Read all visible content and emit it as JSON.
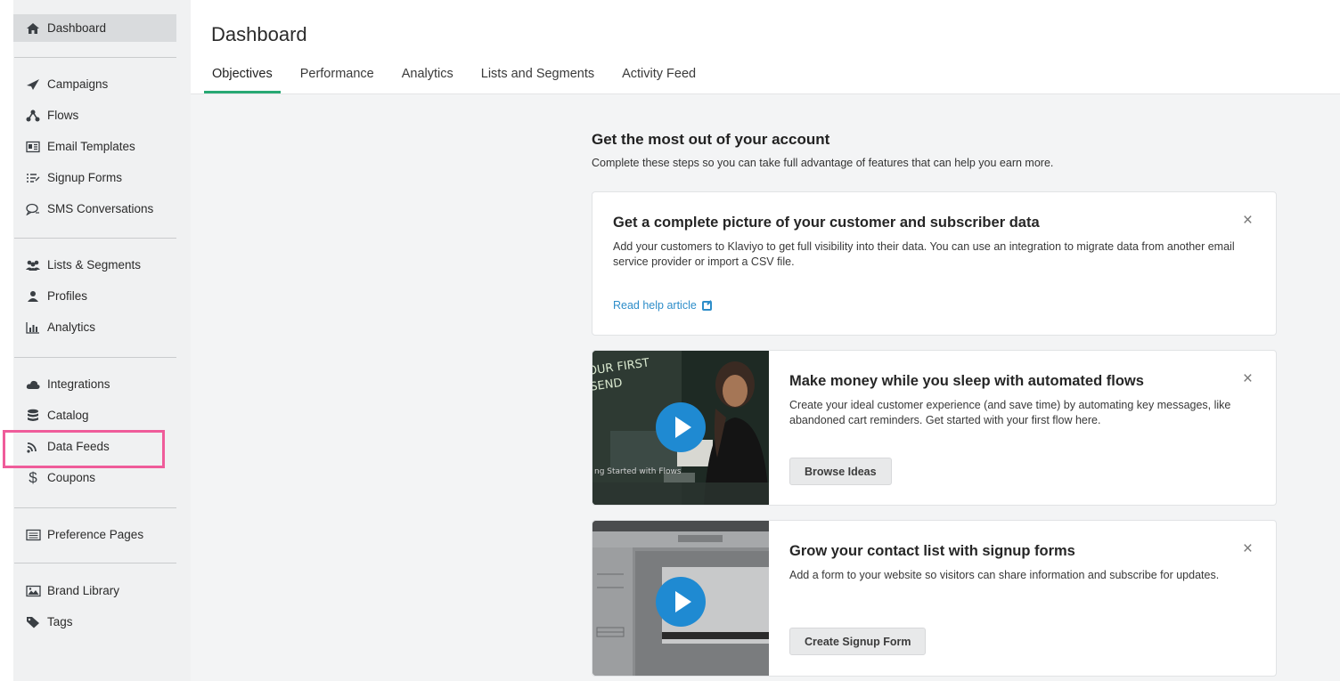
{
  "sidebar": {
    "items": [
      {
        "label": "Dashboard",
        "icon": "home-icon"
      },
      {
        "label": "Campaigns",
        "icon": "paper-plane-icon"
      },
      {
        "label": "Flows",
        "icon": "flow-icon"
      },
      {
        "label": "Email Templates",
        "icon": "template-icon"
      },
      {
        "label": "Signup Forms",
        "icon": "form-list-icon"
      },
      {
        "label": "SMS Conversations",
        "icon": "chat-icon"
      },
      {
        "label": "Lists & Segments",
        "icon": "users-icon"
      },
      {
        "label": "Profiles",
        "icon": "user-icon"
      },
      {
        "label": "Analytics",
        "icon": "bar-chart-icon"
      },
      {
        "label": "Integrations",
        "icon": "cloud-icon"
      },
      {
        "label": "Catalog",
        "icon": "database-icon"
      },
      {
        "label": "Data Feeds",
        "icon": "rss-icon"
      },
      {
        "label": "Coupons",
        "icon": "dollar-icon"
      },
      {
        "label": "Preference Pages",
        "icon": "list-page-icon"
      },
      {
        "label": "Brand Library",
        "icon": "image-icon"
      },
      {
        "label": "Tags",
        "icon": "tag-icon"
      }
    ],
    "highlighted_item": "Data Feeds",
    "highlight_color": "#ef5c9a"
  },
  "header": {
    "title": "Dashboard",
    "tabs": [
      {
        "label": "Objectives",
        "active": true
      },
      {
        "label": "Performance"
      },
      {
        "label": "Analytics"
      },
      {
        "label": "Lists and Segments"
      },
      {
        "label": "Activity Feed"
      }
    ],
    "active_tab_color": "#27a873"
  },
  "main": {
    "intro_title": "Get the most out of your account",
    "intro_subtitle": "Complete these steps so you can take full advantage of features that can help you earn more.",
    "cards": [
      {
        "title": "Get a complete picture of your customer and subscriber data",
        "body": "Add your customers to Klaviyo to get full visibility into their data. You can use an integration to migrate data from another email service provider or import a CSV file.",
        "link": "Read help article",
        "close": "×"
      },
      {
        "title": "Make money while you sleep with automated flows",
        "body": "Create your ideal customer experience (and save time) by automating key messages, like abandoned cart reminders. Get started with your first flow here.",
        "button": "Browse Ideas",
        "close": "×",
        "thumb_text_top": "OUR FIRST\nSEND",
        "thumb_text_bottom": "ng Started with Flows"
      },
      {
        "title": "Grow your contact list with signup forms",
        "body": "Add a form to your website so visitors can share information and subscribe for updates.",
        "button": "Create Signup Form",
        "close": "×"
      }
    ]
  },
  "colors": {
    "link": "#2d8dc9",
    "play_button": "#1f8ad2"
  }
}
